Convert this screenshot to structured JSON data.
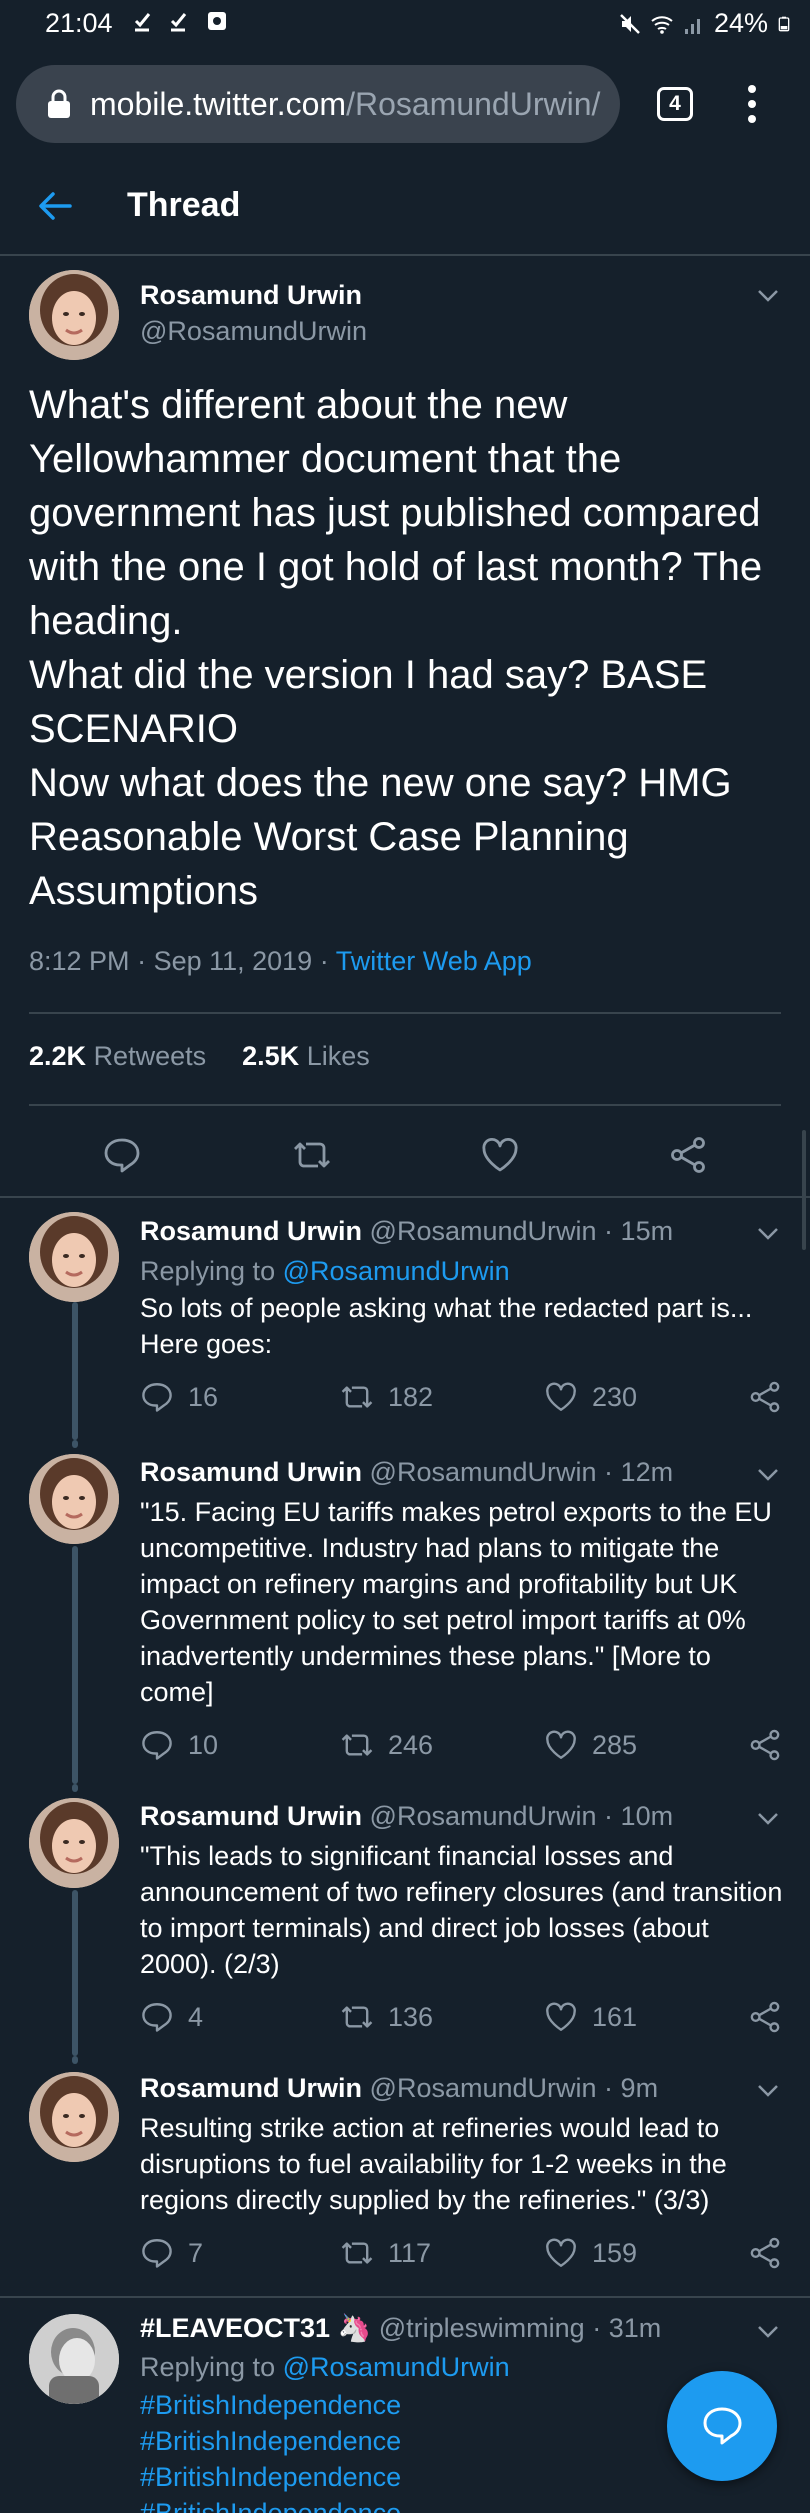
{
  "status_bar": {
    "time": "21:04",
    "battery": "24%"
  },
  "browser": {
    "url_host": "mobile.twitter.com",
    "url_path": "/RosamundUrwin/",
    "tab_count": "4"
  },
  "header": {
    "title": "Thread"
  },
  "main_tweet": {
    "name": "Rosamund Urwin",
    "handle": "@RosamundUrwin",
    "text": "What's different about the new Yellowhammer document that the government has just published compared with the one I got hold of last month? The heading.\nWhat did the version I had say? BASE SCENARIO\nNow what does the new one say? HMG Reasonable Worst Case Planning Assumptions",
    "time": "8:12 PM",
    "date": "Sep 11, 2019",
    "source": "Twitter Web App",
    "retweets_count": "2.2K",
    "retweets_label": "Retweets",
    "likes_count": "2.5K",
    "likes_label": "Likes"
  },
  "replies": [
    {
      "name": "Rosamund Urwin",
      "handle": "@RosamundUrwin",
      "time": "15m",
      "replying_label": "Replying to",
      "replying_to": "@RosamundUrwin",
      "text": "So lots of people asking what the redacted part is... Here goes:",
      "replies": "16",
      "retweets": "182",
      "likes": "230"
    },
    {
      "name": "Rosamund Urwin",
      "handle": "@RosamundUrwin",
      "time": "12m",
      "text": "\"15. Facing EU tariffs makes petrol exports to the EU uncompetitive. Industry had plans to mitigate the impact on refinery margins and profitability but UK Government policy to set petrol import tariffs at 0% inadvertently undermines these plans.\" [More to come]",
      "replies": "10",
      "retweets": "246",
      "likes": "285"
    },
    {
      "name": "Rosamund Urwin",
      "handle": "@RosamundUrwin",
      "time": "10m",
      "text": "\"This leads to significant financial losses and announcement of two refinery closures (and transition to import terminals) and direct job losses (about 2000). (2/3)",
      "replies": "4",
      "retweets": "136",
      "likes": "161"
    },
    {
      "name": "Rosamund Urwin",
      "handle": "@RosamundUrwin",
      "time": "9m",
      "text": "Resulting strike action at refineries would lead to disruptions to fuel availability for 1-2 weeks in the regions directly supplied by the refineries.\" (3/3)",
      "replies": "7",
      "retweets": "117",
      "likes": "159"
    }
  ],
  "other_tweet": {
    "name": "#LEAVEOCT31",
    "handle": "@tripleswimming",
    "time": "31m",
    "replying_label": "Replying to",
    "replying_to": "@RosamundUrwin",
    "hashtags": [
      "#BritishIndependence",
      "#BritishIndependence",
      "#BritishIndependence",
      "#BritishIndependence"
    ]
  },
  "icons": {
    "back": "arrow-left-icon",
    "reply": "reply-icon",
    "retweet": "retweet-icon",
    "like": "heart-icon",
    "share": "share-icon",
    "compose": "compose-message-icon"
  },
  "colors": {
    "background": "#15202b",
    "accent": "#1d9bf0",
    "muted": "#8b98a5",
    "border": "#38444d"
  }
}
